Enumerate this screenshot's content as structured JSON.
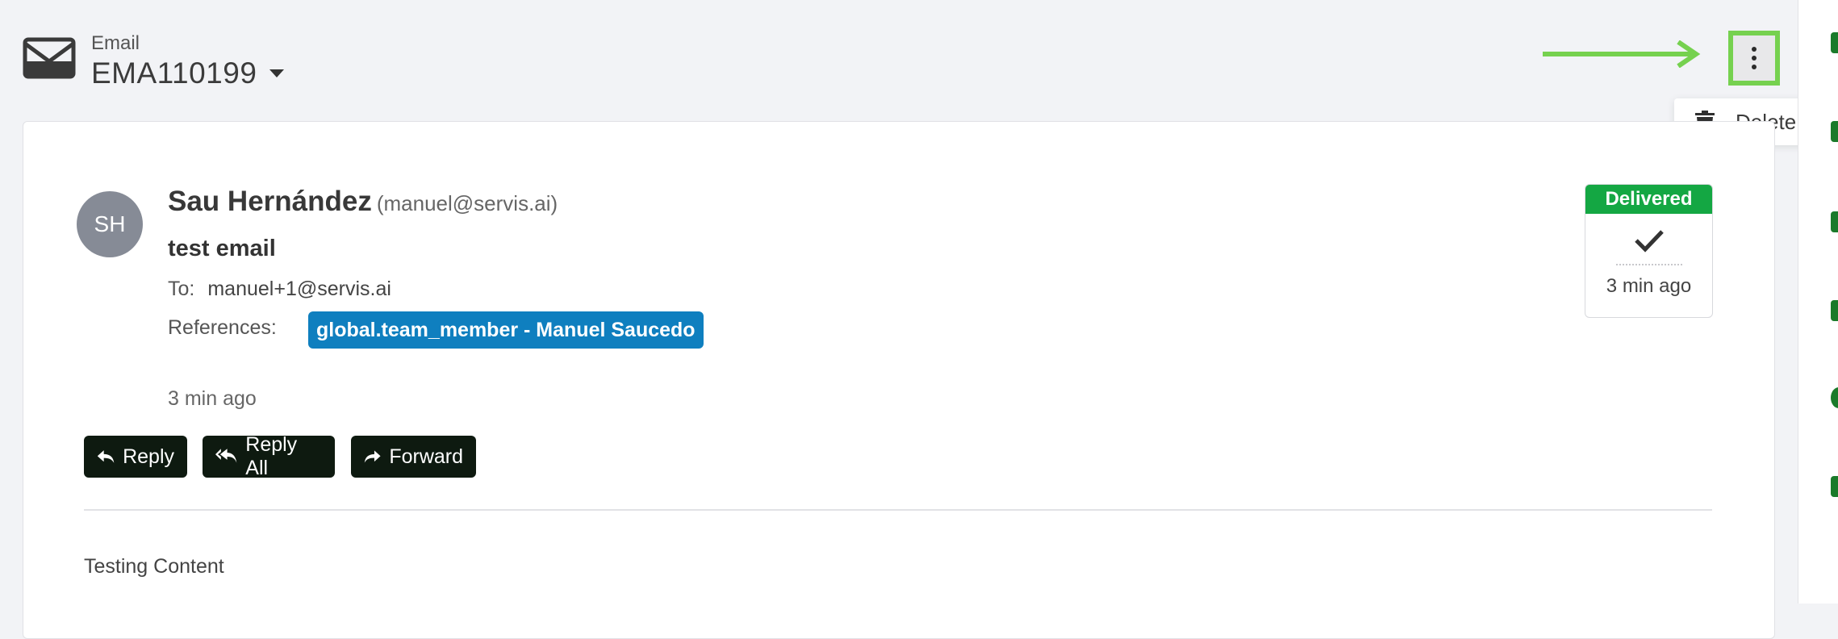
{
  "header": {
    "record_type": "Email",
    "record_id": "EMA110199"
  },
  "menu": {
    "delete_label": "Delete"
  },
  "email": {
    "sender_initials": "SH",
    "sender_name": "Sau Hernández",
    "sender_email": "(manuel@servis.ai)",
    "subject": "test email",
    "to_label": "To:",
    "to_value": "manuel+1@servis.ai",
    "references_label": "References:",
    "reference_tag": "global.team_member - Manuel Saucedo",
    "sent_time": "3 min ago",
    "body": "Testing Content"
  },
  "status": {
    "label": "Delivered",
    "time": "3 min ago"
  },
  "actions": {
    "reply": "Reply",
    "reply_all": "Reply All",
    "forward": "Forward"
  },
  "colors": {
    "annotation_green": "#76d14f",
    "delivered_green": "#14a743",
    "reference_blue": "#0f7fbf",
    "button_dark": "#0e1a10"
  },
  "icons": [
    "envelope-icon",
    "chevron-down-icon",
    "more-vertical-icon",
    "trash-icon",
    "check-icon",
    "reply-icon",
    "reply-all-icon",
    "forward-icon"
  ]
}
